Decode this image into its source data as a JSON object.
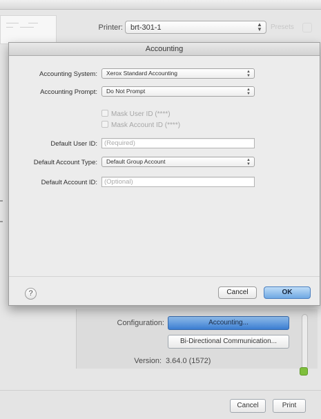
{
  "background": {
    "printer_label": "Printer:",
    "printer_value": "brt-301-1",
    "presets_ghost": "Presets",
    "configuration_label": "Configuration:",
    "accounting_button": "Accounting...",
    "bidirectional_button": "Bi-Directional Communication...",
    "version_label": "Version:",
    "version_value": "3.64.0 (1572)",
    "cancel_label": "Cancel",
    "print_label": "Print"
  },
  "sheet": {
    "title": "Accounting",
    "accounting_system": {
      "label": "Accounting System:",
      "value": "Xerox Standard Accounting"
    },
    "accounting_prompt": {
      "label": "Accounting Prompt:",
      "value": "Do Not Prompt"
    },
    "mask_user_id": "Mask User ID (****)",
    "mask_account_id": "Mask Account ID (****)",
    "default_user_id": {
      "label": "Default User ID:",
      "placeholder": "(Required)"
    },
    "default_account_type": {
      "label": "Default Account Type:",
      "value": "Default Group Account"
    },
    "default_account_id": {
      "label": "Default Account ID:",
      "placeholder": "(Optional)"
    },
    "help_glyph": "?",
    "cancel_label": "Cancel",
    "ok_label": "OK"
  },
  "colors": {
    "accent_blue": "#6fa8e3",
    "status_green": "#7fbf3c"
  }
}
